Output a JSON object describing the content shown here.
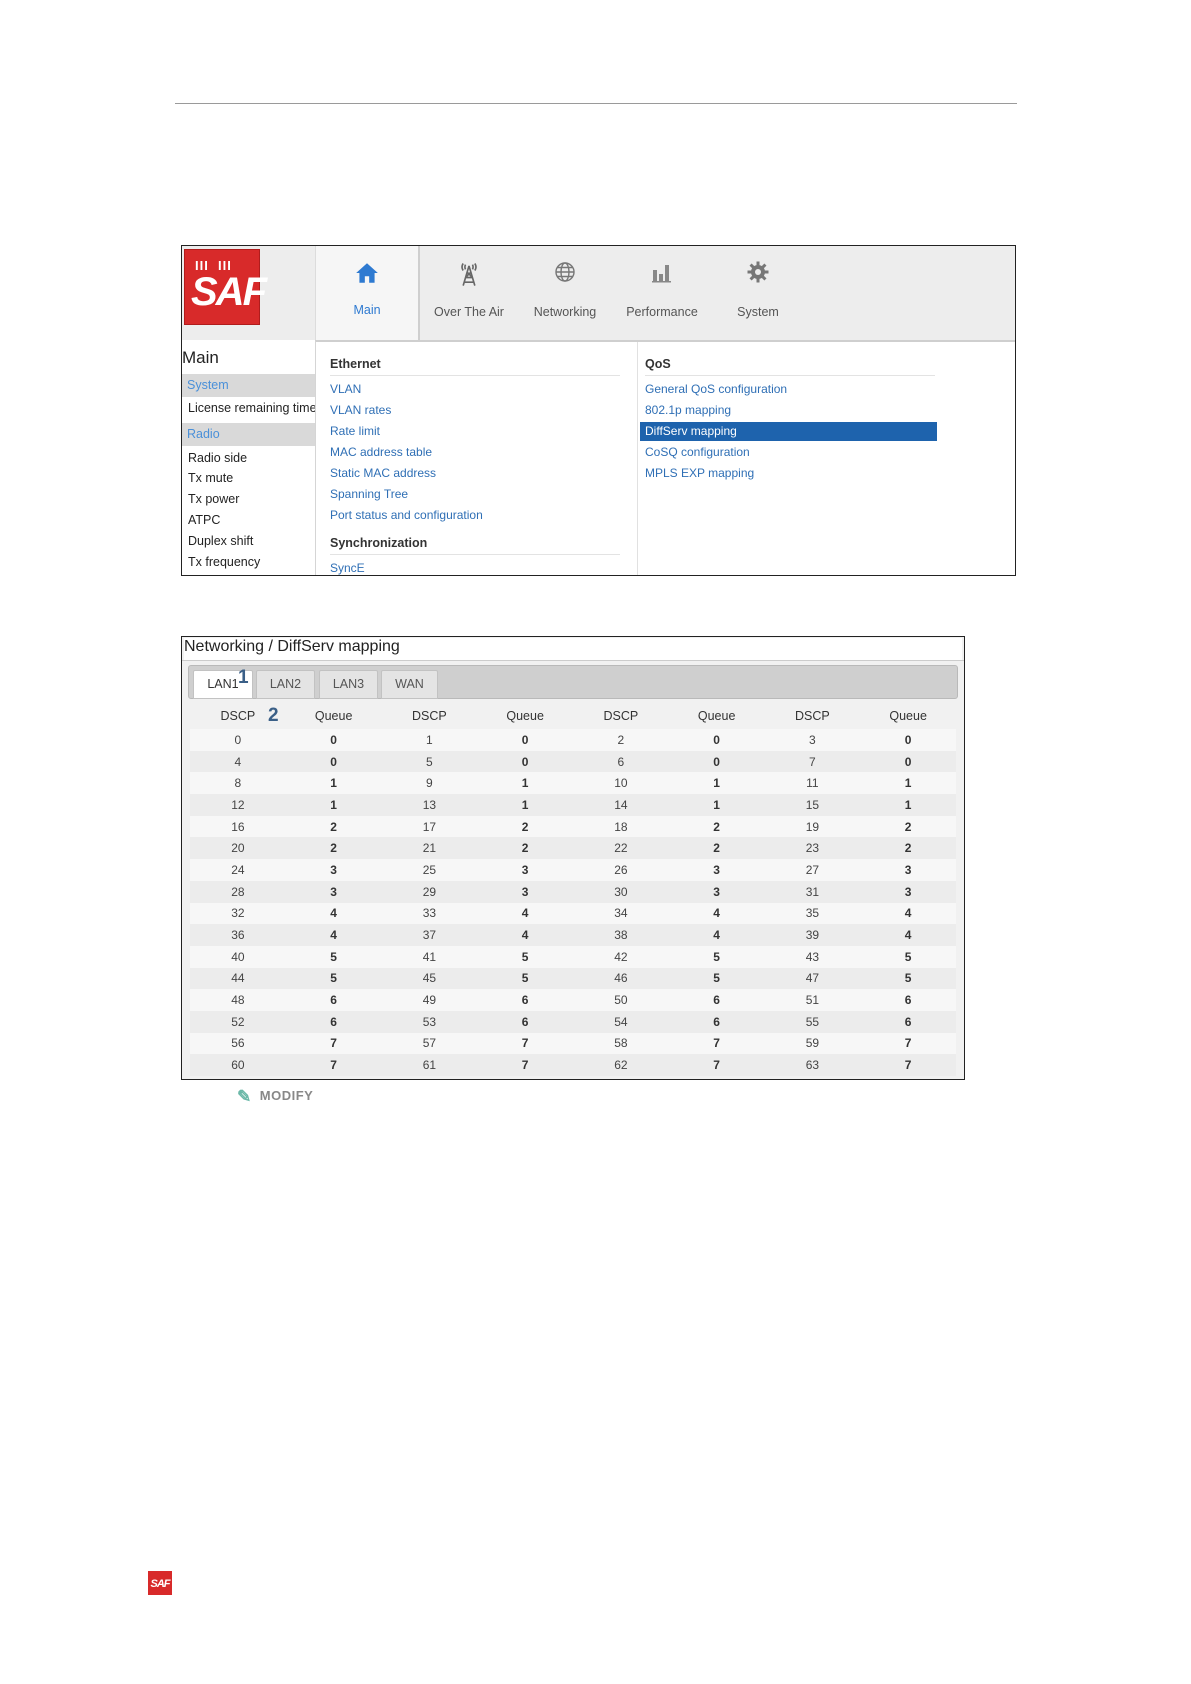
{
  "brand": {
    "logo_text": "SAF",
    "accent": "#d82a2a",
    "link_color": "#2f6fb5",
    "selected_bg": "#1e63ad"
  },
  "topnav": {
    "items": [
      {
        "label": "Main",
        "icon": "home-icon"
      },
      {
        "label": "Over The Air",
        "icon": "antenna-tower-icon"
      },
      {
        "label": "Networking",
        "icon": "globe-icon"
      },
      {
        "label": "Performance",
        "icon": "bar-chart-icon"
      },
      {
        "label": "System",
        "icon": "gear-icon"
      }
    ]
  },
  "sidebar": {
    "title": "Main",
    "section_system": "System",
    "license": "License remaining time",
    "section_radio": "Radio",
    "items": [
      "Radio side",
      "Tx mute",
      "Tx power",
      "ATPC",
      "Duplex shift",
      "Tx frequency"
    ]
  },
  "menu": {
    "ethernet": {
      "heading": "Ethernet",
      "links": [
        "VLAN",
        "VLAN rates",
        "Rate limit",
        "MAC address table",
        "Static MAC address",
        "Spanning Tree",
        "Port status and configuration"
      ]
    },
    "sync": {
      "heading": "Synchronization",
      "links": [
        "SyncE"
      ]
    },
    "qos": {
      "heading": "QoS",
      "links": [
        "General QoS configuration",
        "802.1p mapping",
        "DiffServ mapping",
        "CoSQ configuration",
        "MPLS EXP mapping"
      ],
      "selected": "DiffServ mapping"
    }
  },
  "diffserv": {
    "title": "Networking / DiffServ mapping",
    "tabs": [
      "LAN1",
      "LAN2",
      "LAN3",
      "WAN"
    ],
    "active_tab": "LAN1",
    "callout_1": "1",
    "callout_2": "2",
    "headers": [
      "DSCP",
      "Queue",
      "DSCP",
      "Queue",
      "DSCP",
      "Queue",
      "DSCP",
      "Queue"
    ],
    "rows": [
      [
        "0",
        "0",
        "1",
        "0",
        "2",
        "0",
        "3",
        "0"
      ],
      [
        "4",
        "0",
        "5",
        "0",
        "6",
        "0",
        "7",
        "0"
      ],
      [
        "8",
        "1",
        "9",
        "1",
        "10",
        "1",
        "11",
        "1"
      ],
      [
        "12",
        "1",
        "13",
        "1",
        "14",
        "1",
        "15",
        "1"
      ],
      [
        "16",
        "2",
        "17",
        "2",
        "18",
        "2",
        "19",
        "2"
      ],
      [
        "20",
        "2",
        "21",
        "2",
        "22",
        "2",
        "23",
        "2"
      ],
      [
        "24",
        "3",
        "25",
        "3",
        "26",
        "3",
        "27",
        "3"
      ],
      [
        "28",
        "3",
        "29",
        "3",
        "30",
        "3",
        "31",
        "3"
      ],
      [
        "32",
        "4",
        "33",
        "4",
        "34",
        "4",
        "35",
        "4"
      ],
      [
        "36",
        "4",
        "37",
        "4",
        "38",
        "4",
        "39",
        "4"
      ],
      [
        "40",
        "5",
        "41",
        "5",
        "42",
        "5",
        "43",
        "5"
      ],
      [
        "44",
        "5",
        "45",
        "5",
        "46",
        "5",
        "47",
        "5"
      ],
      [
        "48",
        "6",
        "49",
        "6",
        "50",
        "6",
        "51",
        "6"
      ],
      [
        "52",
        "6",
        "53",
        "6",
        "54",
        "6",
        "55",
        "6"
      ],
      [
        "56",
        "7",
        "57",
        "7",
        "58",
        "7",
        "59",
        "7"
      ],
      [
        "60",
        "7",
        "61",
        "7",
        "62",
        "7",
        "63",
        "7"
      ]
    ],
    "modify_label": "MODIFY"
  },
  "footer": {
    "logo_text": "SAF"
  }
}
